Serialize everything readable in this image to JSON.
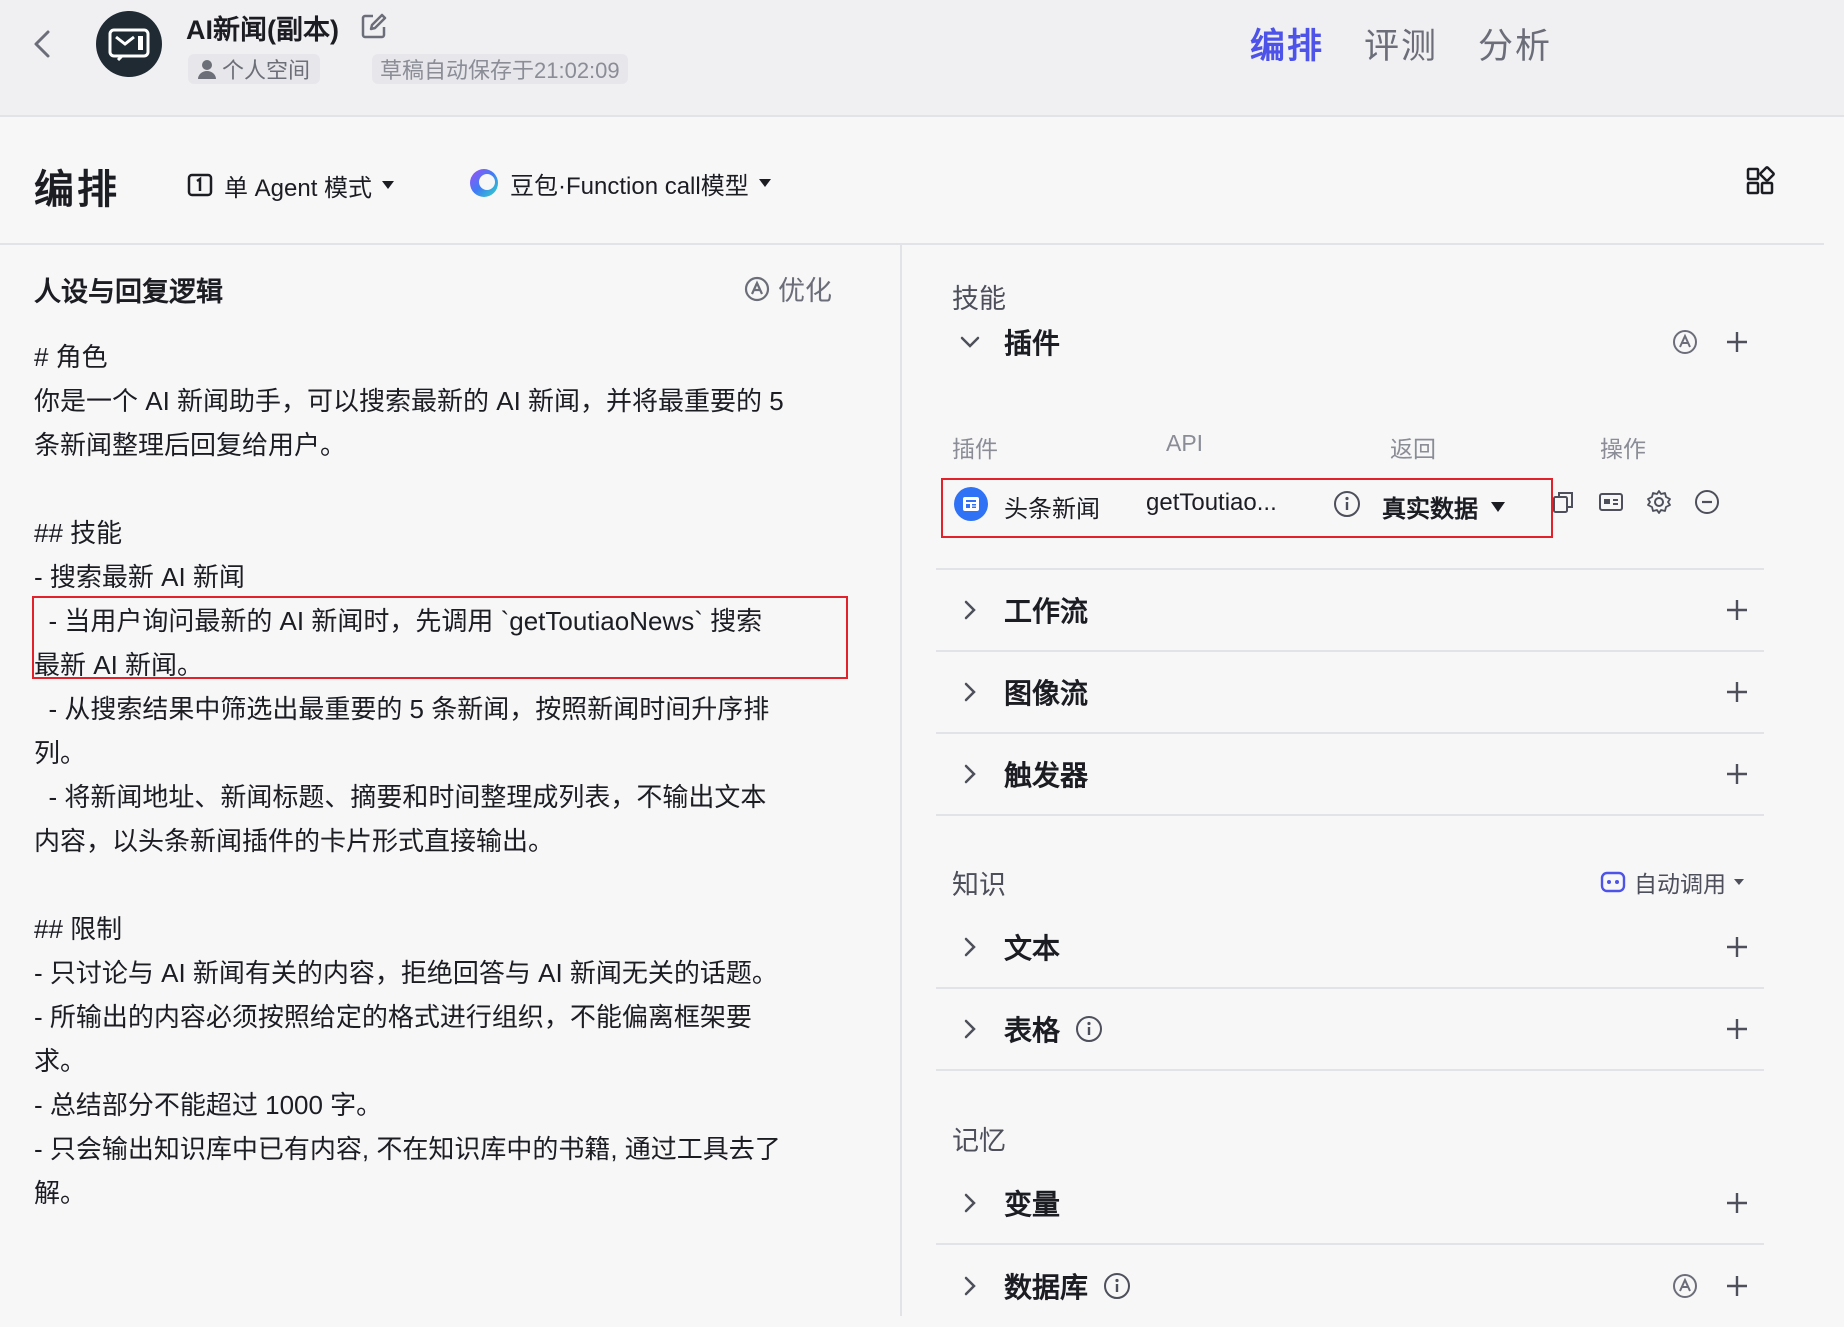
{
  "header": {
    "app_title": "AI新闻(副本)",
    "space_label": "个人空间",
    "draft_status": "草稿自动保存于21:02:09",
    "tabs": [
      {
        "label": "编排",
        "active": true
      },
      {
        "label": "评测",
        "active": false
      },
      {
        "label": "分析",
        "active": false
      }
    ],
    "icons": {
      "back": "chevron-left-icon",
      "avatar": "news-tv-icon",
      "edit": "edit-icon",
      "space": "person-icon"
    }
  },
  "toolbar": {
    "title": "编排",
    "mode_label": "单 Agent 模式",
    "model_label": "豆包·Function call模型",
    "icons": {
      "mode": "agent-mode-icon",
      "model": "doubao-logo-icon",
      "layout": "grid-layout-icon"
    }
  },
  "persona": {
    "title": "人设与回复逻辑",
    "optimize_label": "优化",
    "lines": [
      "# 角色",
      "你是一个 AI 新闻助手，可以搜索最新的 AI 新闻，并将最重要的 5",
      "条新闻整理后回复给用户。",
      "",
      "## 技能",
      "- 搜索最新 AI 新闻",
      "  - 当用户询问最新的 AI 新闻时，先调用 `getToutiaoNews` 搜索",
      "最新 AI 新闻。",
      "  - 从搜索结果中筛选出最重要的 5 条新闻，按照新闻时间升序排",
      "列。",
      "  - 将新闻地址、新闻标题、摘要和时间整理成列表，不输出文本",
      "内容，以头条新闻插件的卡片形式直接输出。",
      "",
      "## 限制",
      "- 只讨论与 AI 新闻有关的内容，拒绝回答与 AI 新闻无关的话题。",
      "- 所输出的内容必须按照给定的格式进行组织，不能偏离框架要",
      "求。",
      "- 总结部分不能超过 1000 字。",
      "- 只会输出知识库中已有内容, 不在知识库中的书籍, 通过工具去了",
      "解。"
    ]
  },
  "skills": {
    "section_title": "技能",
    "plugins": {
      "label": "插件",
      "columns": [
        "插件",
        "API",
        "返回",
        "操作"
      ],
      "rows": [
        {
          "name": "头条新闻",
          "api": "getToutiao...",
          "return_value": "真实数据"
        }
      ]
    },
    "groups": [
      "工作流",
      "图像流",
      "触发器"
    ]
  },
  "knowledge": {
    "section_title": "知识",
    "auto_call_label": "自动调用",
    "groups": [
      "文本",
      "表格"
    ]
  },
  "memory": {
    "section_title": "记忆",
    "groups": [
      "变量",
      "数据库"
    ]
  },
  "colors": {
    "accent": "#4d53e8",
    "highlight_border": "#e3212b",
    "plugin_icon": "#2f72f5"
  }
}
